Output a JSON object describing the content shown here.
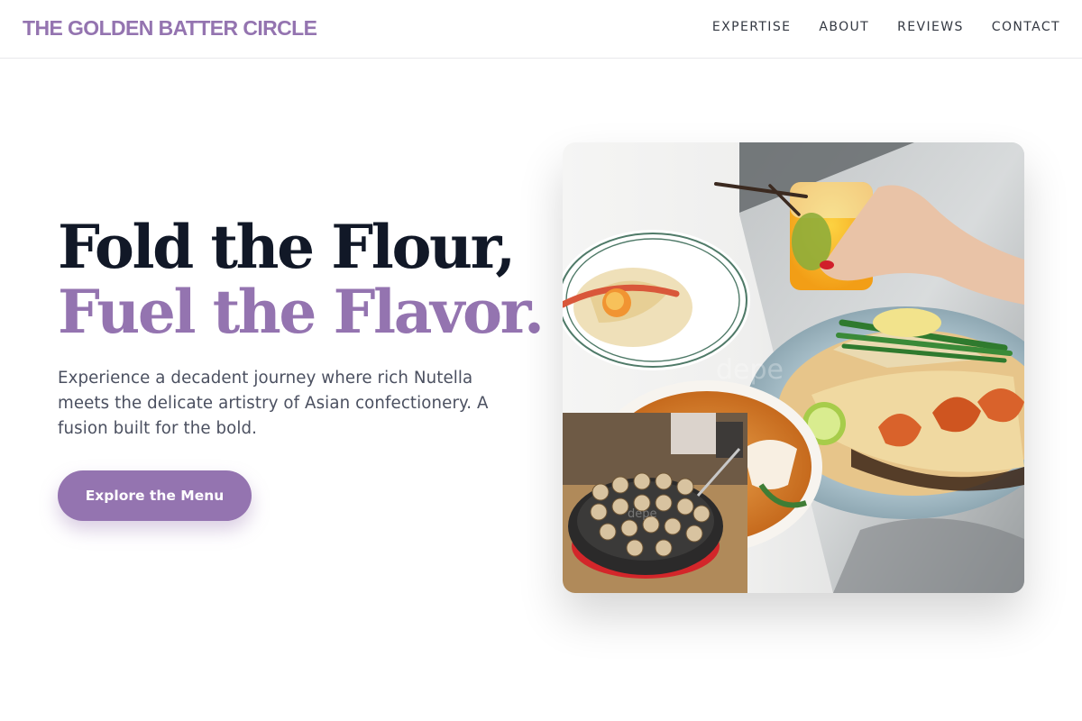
{
  "header": {
    "brand": "THE GOLDEN BATTER CIRCLE",
    "nav": [
      {
        "label": "EXPERTISE"
      },
      {
        "label": "ABOUT"
      },
      {
        "label": "REVIEWS"
      },
      {
        "label": "CONTACT"
      }
    ]
  },
  "hero": {
    "title_line_1": "Fold the Flour,",
    "title_line_2": "Fuel the Flavor.",
    "subtitle": "Experience a decadent journey where rich Nutella meets the delicate artistry of Asian confectionery. A fusion built for the bold.",
    "cta_label": "Explore the Menu"
  },
  "media": {
    "main_image": "food-spread-photo",
    "inset_image": "takoyaki-pan-photo"
  },
  "colors": {
    "accent": "#9474b0",
    "heading": "#111827",
    "body_text": "#4b5060",
    "border": "#e8e8ec"
  }
}
